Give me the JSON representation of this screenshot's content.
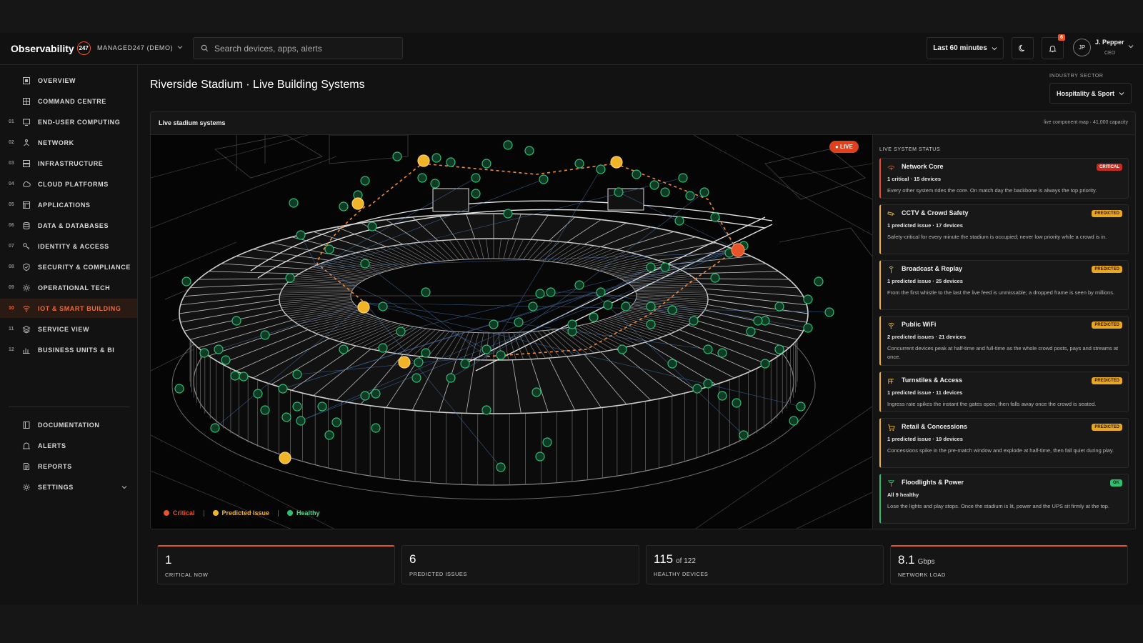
{
  "header": {
    "brand": "Observability",
    "brand_mark": "247",
    "org": "MANAGED247 (DEMO)",
    "search_placeholder": "Search devices, apps, alerts",
    "time_range": "Last 60 minutes",
    "notifications_count": "6",
    "user": {
      "initials": "JP",
      "name": "J. Pepper",
      "role": "CEO"
    }
  },
  "sidebar": {
    "items": [
      {
        "num": "",
        "label": "OVERVIEW",
        "icon": "overview-icon"
      },
      {
        "num": "",
        "label": "COMMAND CENTRE",
        "icon": "grid-icon"
      },
      {
        "num": "01",
        "label": "END-USER COMPUTING",
        "icon": "monitor-icon"
      },
      {
        "num": "02",
        "label": "NETWORK",
        "icon": "network-icon"
      },
      {
        "num": "03",
        "label": "INFRASTRUCTURE",
        "icon": "server-icon"
      },
      {
        "num": "04",
        "label": "CLOUD PLATFORMS",
        "icon": "cloud-icon"
      },
      {
        "num": "05",
        "label": "APPLICATIONS",
        "icon": "app-window-icon"
      },
      {
        "num": "06",
        "label": "DATA & DATABASES",
        "icon": "database-icon"
      },
      {
        "num": "07",
        "label": "IDENTITY & ACCESS",
        "icon": "key-icon"
      },
      {
        "num": "08",
        "label": "SECURITY & COMPLIANCE",
        "icon": "shield-icon"
      },
      {
        "num": "09",
        "label": "OPERATIONAL TECH",
        "icon": "gear-icon"
      },
      {
        "num": "10",
        "label": "IOT & SMART BUILDING",
        "icon": "wifi-icon"
      },
      {
        "num": "11",
        "label": "SERVICE VIEW",
        "icon": "layers-icon"
      },
      {
        "num": "12",
        "label": "BUSINESS UNITS & BI",
        "icon": "bar-chart-icon"
      }
    ],
    "secondary": [
      {
        "label": "DOCUMENTATION",
        "icon": "book-icon"
      },
      {
        "label": "ALERTS",
        "icon": "bell-icon"
      },
      {
        "label": "REPORTS",
        "icon": "document-icon"
      },
      {
        "label": "SETTINGS",
        "icon": "gear-icon"
      }
    ],
    "active_index": 11
  },
  "page": {
    "title": "Riverside Stadium · Live Building Systems",
    "sector_label": "INDUSTRY SECTOR",
    "sector_value": "Hospitality & Sport"
  },
  "panel": {
    "title": "Live stadium systems",
    "subtitle": "live component map · 41,000 capacity",
    "live_label": "● LIVE",
    "legend": [
      {
        "label": "Critical",
        "color": "#e8542a"
      },
      {
        "label": "Predicted Issue",
        "color": "#f0b429"
      },
      {
        "label": "Healthy",
        "color": "#2fbf71"
      }
    ]
  },
  "status": {
    "heading": "LIVE SYSTEM STATUS",
    "cards": [
      {
        "name": "Network Core",
        "badge": "CRITICAL",
        "level": "crit",
        "icon": "network-core-icon",
        "count": "1 critical · 15 devices",
        "desc": "Every other system rides the core. On match day the backbone is always the top priority."
      },
      {
        "name": "CCTV & Crowd Safety",
        "badge": "PREDICTED",
        "level": "pred",
        "icon": "cctv-icon",
        "count": "1 predicted issue · 17 devices",
        "desc": "Safety-critical for every minute the stadium is occupied; never low priority while a crowd is in."
      },
      {
        "name": "Broadcast & Replay",
        "badge": "PREDICTED",
        "level": "pred",
        "icon": "broadcast-icon",
        "count": "1 predicted issue · 25 devices",
        "desc": "From the first whistle to the last the live feed is unmissable; a dropped frame is seen by millions."
      },
      {
        "name": "Public WiFi",
        "badge": "PREDICTED",
        "level": "pred",
        "icon": "wifi-icon",
        "count": "2 predicted issues · 21 devices",
        "desc": "Concurrent devices peak at half-time and full-time as the whole crowd posts, pays and streams at once."
      },
      {
        "name": "Turnstiles & Access",
        "badge": "PREDICTED",
        "level": "pred",
        "icon": "turnstile-icon",
        "count": "1 predicted issue · 11 devices",
        "desc": "Ingress rate spikes the instant the gates open, then falls away once the crowd is seated."
      },
      {
        "name": "Retail & Concessions",
        "badge": "PREDICTED",
        "level": "pred",
        "icon": "cart-icon",
        "count": "1 predicted issue · 19 devices",
        "desc": "Concessions spike in the pre-match window and explode at half-time, then fall quiet during play."
      },
      {
        "name": "Floodlights & Power",
        "badge": "OK",
        "level": "ok",
        "icon": "floodlight-icon",
        "count": "All 9 healthy",
        "desc": "Lose the lights and play stops. Once the stadium is lit, power and the UPS sit firmly at the top."
      }
    ]
  },
  "stats": [
    {
      "value": "1",
      "unit": "",
      "label": "CRITICAL NOW",
      "highlight": true
    },
    {
      "value": "6",
      "unit": "",
      "label": "PREDICTED ISSUES",
      "highlight": false
    },
    {
      "value": "115",
      "unit": "of 122",
      "label": "HEALTHY DEVICES",
      "highlight": false
    },
    {
      "value": "8.1",
      "unit": "Gbps",
      "label": "NETWORK LOAD",
      "highlight": true
    }
  ]
}
